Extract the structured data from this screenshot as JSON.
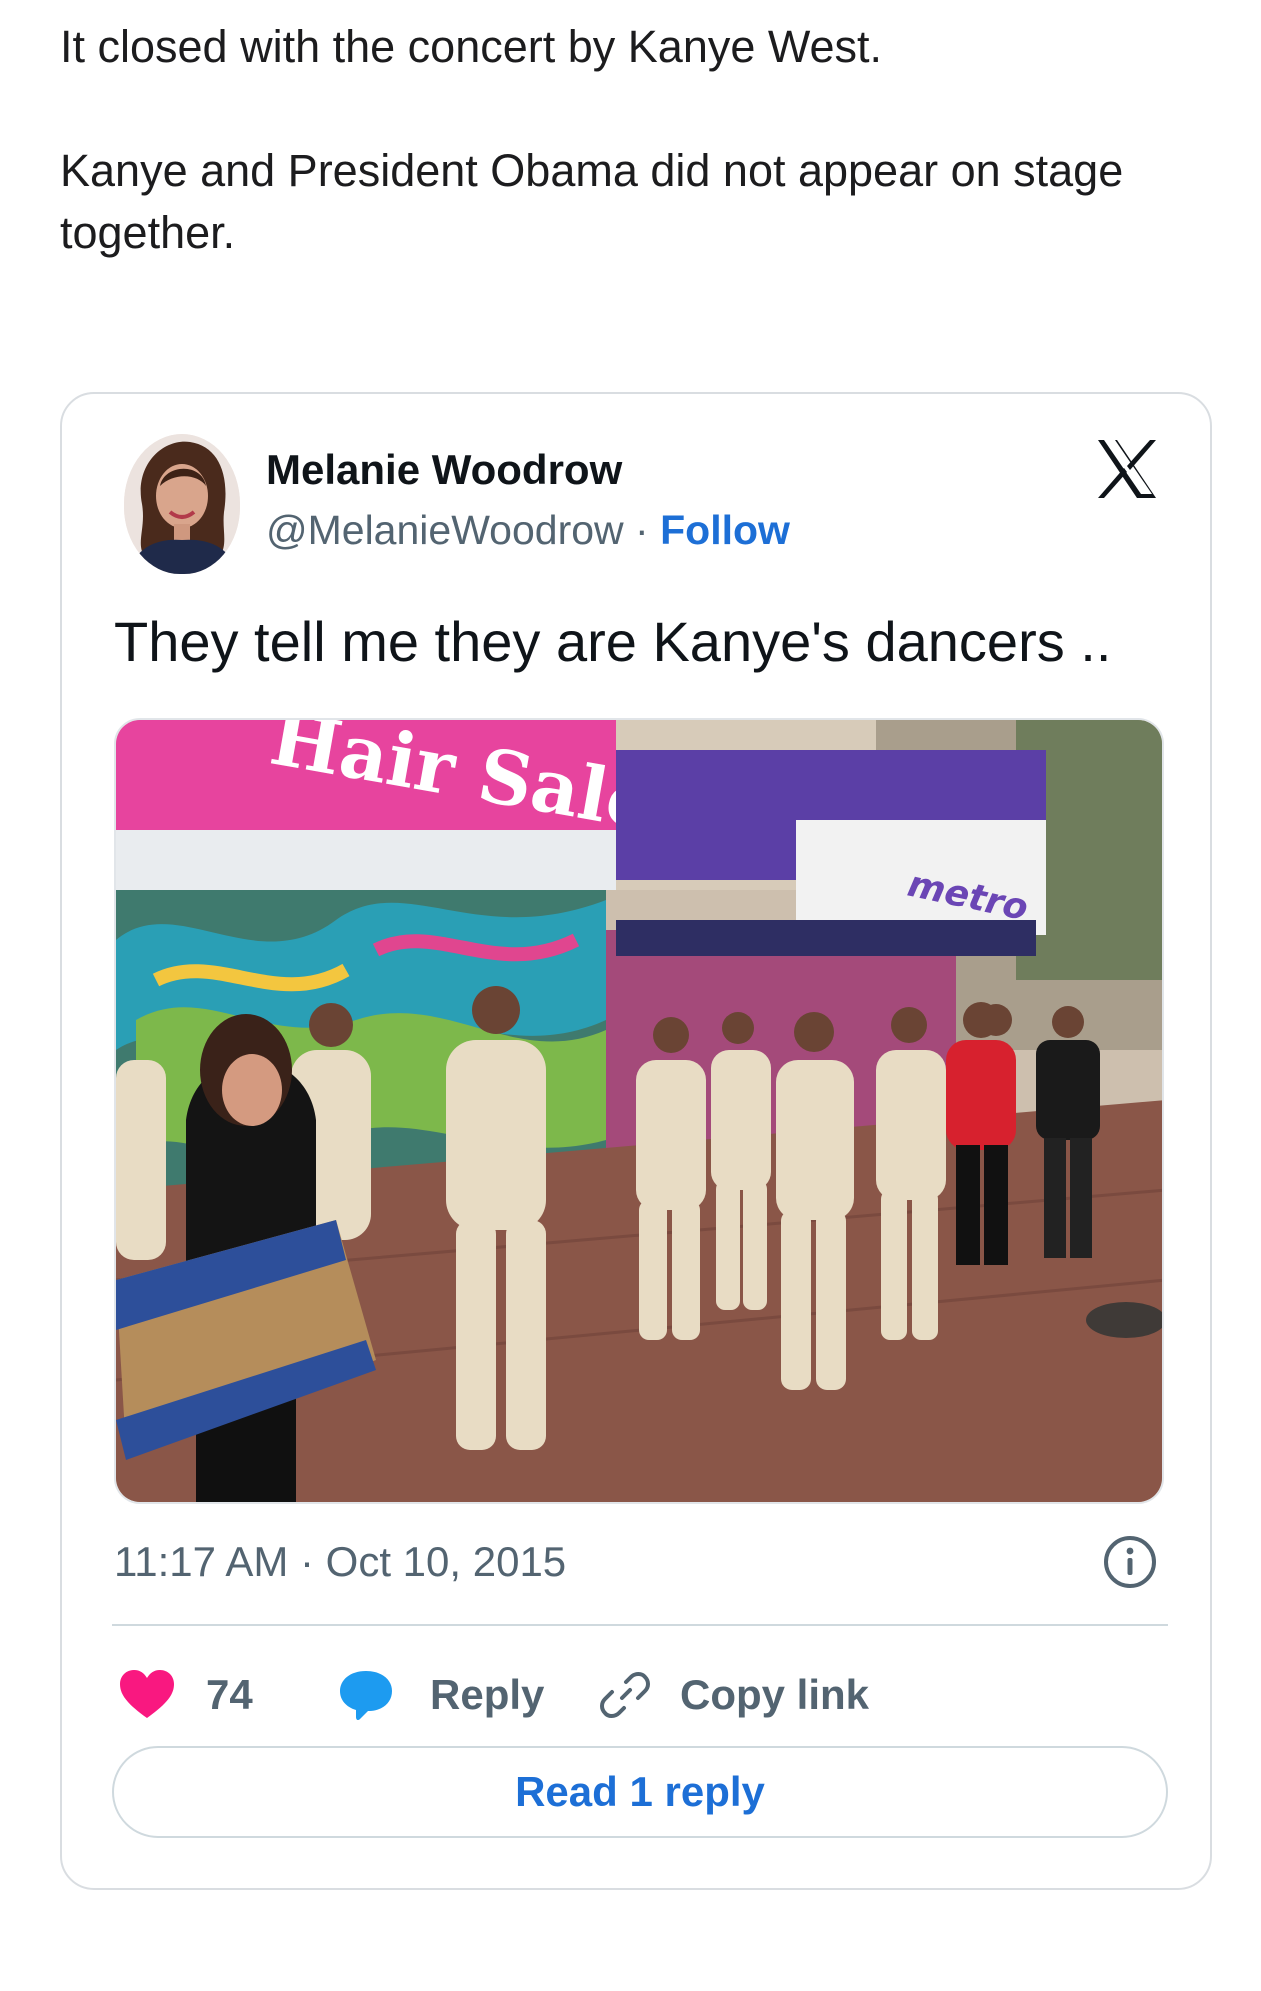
{
  "article": {
    "paragraph_1": "It closed with the concert by Kanye West.",
    "paragraph_2": "Kanye and President Obama did not appear on stage together."
  },
  "tweet": {
    "author_name": "Melanie Woodrow",
    "author_handle": "@MelanieWoodrow",
    "separator": "·",
    "follow_label": "Follow",
    "text": "They tell me they are Kanye's dancers ..",
    "timestamp": "11:17 AM · Oct 10, 2015",
    "like_count": "74",
    "reply_label": "Reply",
    "copy_link_label": "Copy link",
    "read_replies_label": "Read 1 reply",
    "media_signs": {
      "storefront": "Hair Salon",
      "store_right": "metro"
    }
  },
  "icons": {
    "platform_logo": "x-logo-icon",
    "info": "info-icon",
    "like": "heart-icon",
    "reply": "speech-bubble-icon",
    "copy_link": "link-icon"
  },
  "colors": {
    "accent_blue": "#1d6fd6",
    "like_pink": "#f91880",
    "reply_blue": "#1d9bf0",
    "muted_text": "#536471",
    "border": "#cfd9de"
  }
}
